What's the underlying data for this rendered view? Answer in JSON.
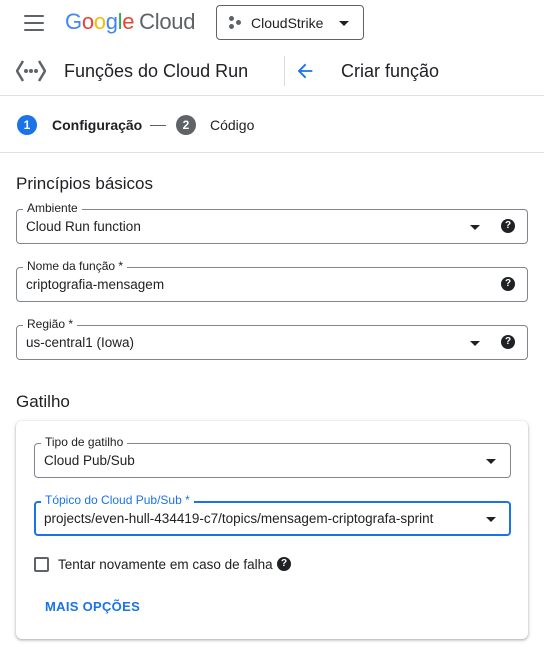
{
  "topbar": {
    "logo_google": [
      "G",
      "o",
      "o",
      "g",
      "l",
      "e"
    ],
    "logo_cloud": "Cloud",
    "project_name": "CloudStrike"
  },
  "header": {
    "service_title": "Funções do Cloud Run",
    "page_title": "Criar função"
  },
  "stepper": {
    "steps": [
      {
        "number": "1",
        "label": "Configuração",
        "active": true
      },
      {
        "number": "2",
        "label": "Código",
        "active": false
      }
    ]
  },
  "basics": {
    "title": "Princípios básicos",
    "environment": {
      "label": "Ambiente",
      "value": "Cloud Run function"
    },
    "function_name": {
      "label": "Nome da função *",
      "value": "criptografia-mensagem"
    },
    "region": {
      "label": "Região *",
      "value": "us-central1 (Iowa)"
    }
  },
  "trigger": {
    "title": "Gatilho",
    "trigger_type": {
      "label": "Tipo de gatilho",
      "value": "Cloud Pub/Sub"
    },
    "topic": {
      "label": "Tópico do Cloud Pub/Sub *",
      "value": "projects/even-hull-434419-c7/topics/mensagem-criptografa-sprint"
    },
    "retry_label": "Tentar novamente em caso de falha",
    "retry_checked": false,
    "more_options": "MAIS OPÇÕES"
  },
  "icons": {
    "menu": "hamburger-menu-icon",
    "project": "project-hierarchy-icon",
    "function": "cloud-functions-icon",
    "back": "arrow-back-icon",
    "help": "help-circle-icon",
    "dropdown": "caret-down-icon"
  },
  "colors": {
    "accent": "#1a73e8",
    "text": "#202124",
    "muted": "#5f6368",
    "google_blue": "#4285f4",
    "google_red": "#ea4335",
    "google_yellow": "#fbbc05",
    "google_green": "#34a853"
  },
  "help_glyph": "?"
}
